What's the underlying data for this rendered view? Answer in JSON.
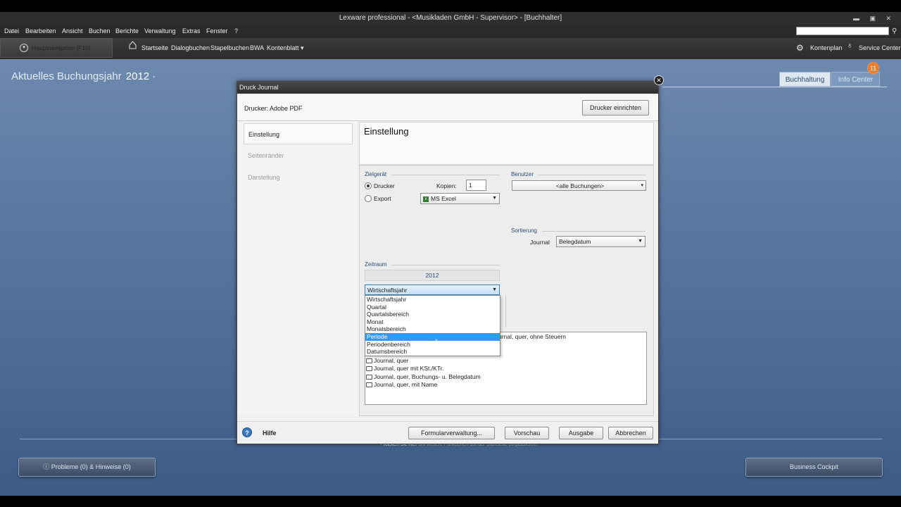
{
  "window": {
    "title": "Lexware professional - <Musikladen GmbH - Supervisor> - [Buchhalter]",
    "controls": "▬ ▣ ✕"
  },
  "menu": [
    "Datei",
    "Bearbeiten",
    "Ansicht",
    "Buchen",
    "Berichte",
    "Verwaltung",
    "Extras",
    "Fenster",
    "?"
  ],
  "nav": {
    "main_button": "Hauptnavigation [F10]",
    "items": [
      "Startseite",
      "Dialogbuchen",
      "Stapelbuchen",
      "BWA",
      "Kontenblatt ▾"
    ],
    "right": [
      "Kontenplan",
      "Service Center"
    ]
  },
  "main": {
    "year_label": "Aktuelles Buchungsjahr",
    "year_value": "2012 ·",
    "tabs": [
      "Buchhaltung",
      "Info Center"
    ],
    "badge": "11",
    "problems_button": "Probleme (0) & Hinweise (0)",
    "cockpit_button": "Business Cockpit",
    "hint_prefix": "• Klicken Sie hier",
    "hint_rest": "um weitere Funktionen auf der Startseite zu platzieren."
  },
  "dialog": {
    "title": "Druck Journal",
    "printer_label": "Drucker:  Adobe PDF",
    "setup_printer": "Drucker einrichten",
    "left_nav": [
      "Einstellung",
      "Seitenränder",
      "Darstellung"
    ],
    "content_title": "Einstellung",
    "zielgeraet": {
      "heading": "Zielgerät",
      "drucker": "Drucker",
      "export": "Export",
      "kopien_label": "Kopien:",
      "kopien_value": "1",
      "export_format": "MS Excel"
    },
    "benutzer": {
      "heading": "Benutzer",
      "value": "<alle Buchungen>"
    },
    "sortierung": {
      "heading": "Sortierung",
      "label": "Journal",
      "value": "Belegdatum"
    },
    "zeitraum": {
      "heading": "Zeitraum",
      "year": "2012",
      "selected": "Wirtschaftsjahr",
      "options": [
        "Wirtschaftsjahr",
        "Quartal",
        "Quartalsbereich",
        "Monat",
        "Monatsbereich",
        "Periode",
        "Periodenbereich",
        "Datumsbereich"
      ],
      "highlighted": "Periode"
    },
    "list_items": [
      "urnal, quer, ohne Steuern",
      "Journal, quer",
      "Journal, quer mit KSt./KTr.",
      "Journal, quer, Buchungs- u. Belegdatum",
      "Journal, quer, mit Name"
    ],
    "footer": {
      "help": "Hilfe",
      "buttons": [
        "Formularverwaltung...",
        "Vorschau",
        "Ausgabe",
        "Abbrechen"
      ]
    }
  },
  "colors": {
    "accent": "#3399ff",
    "badge": "#ec7d2a",
    "background": "#5d7aa3"
  }
}
